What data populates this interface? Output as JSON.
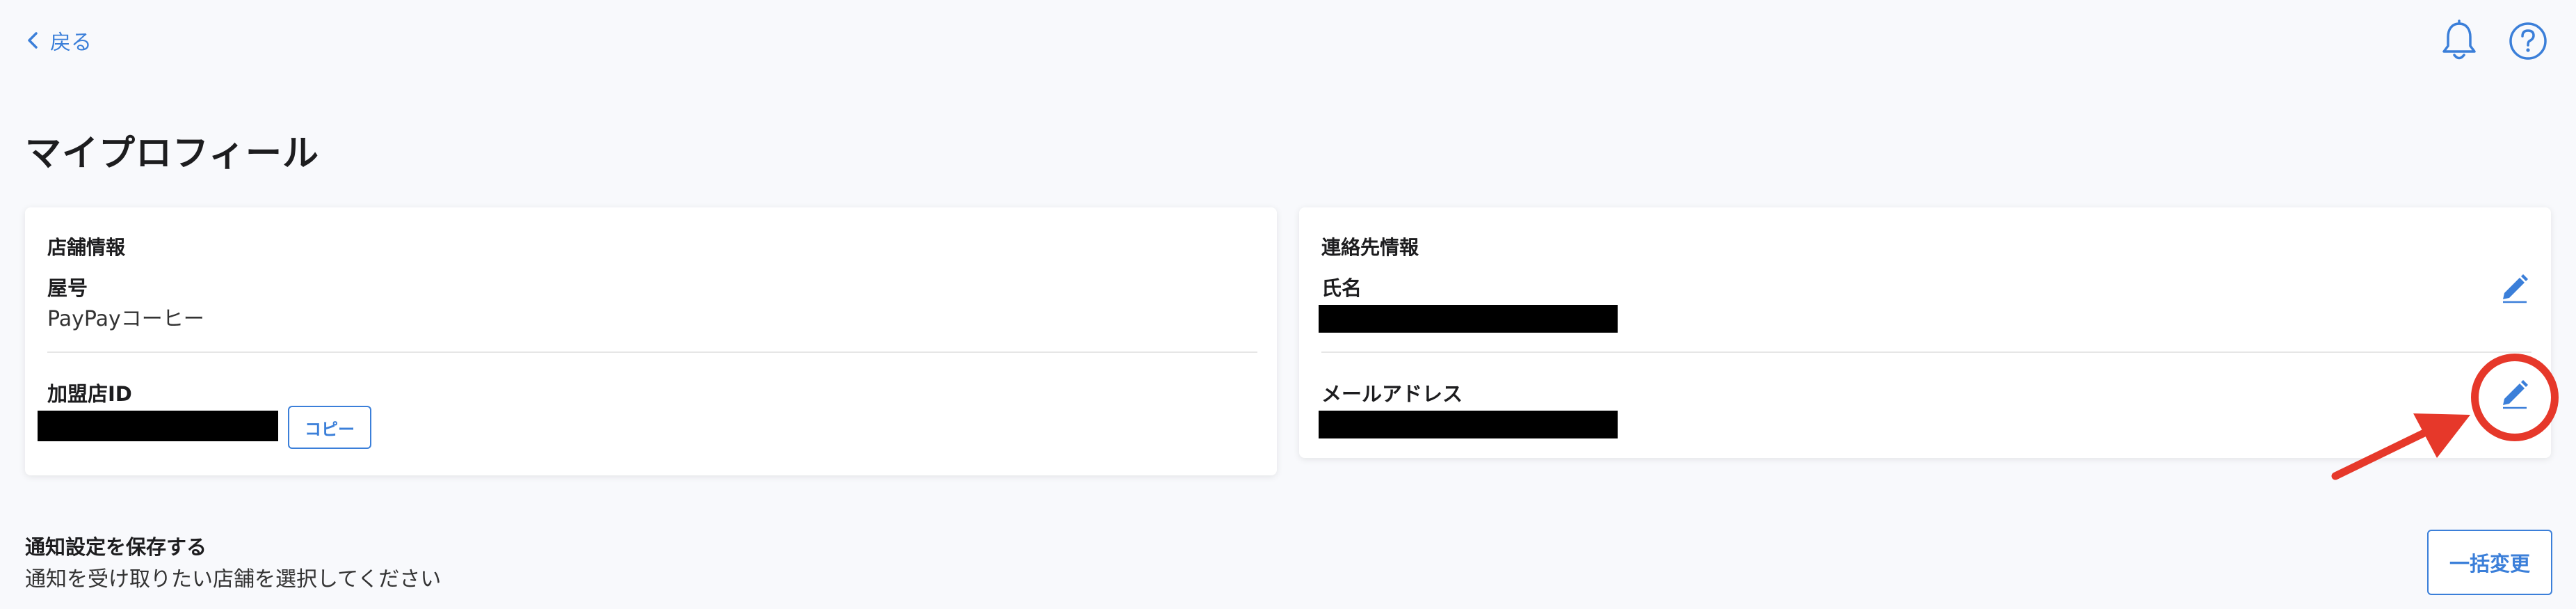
{
  "header": {
    "back_label": "戻る",
    "bell_icon": "bell-icon",
    "help_icon": "question-circle-icon"
  },
  "page": {
    "title": "マイプロフィール"
  },
  "store_info": {
    "section_title": "店舗情報",
    "shop_name_label": "屋号",
    "shop_name_value": "PayPayコーヒー",
    "merchant_id_label": "加盟店ID",
    "copy_button_label": "コピー"
  },
  "contact_info": {
    "section_title": "連絡先情報",
    "name_label": "氏名",
    "email_label": "メールアドレス"
  },
  "notification": {
    "title": "通知設定を保存する",
    "description": "通知を受け取りたい店舗を選択してください",
    "bulk_change_label": "一括変更"
  },
  "colors": {
    "accent": "#3b7fd9",
    "annotation": "#e6382a",
    "background": "#f8f9fc"
  }
}
